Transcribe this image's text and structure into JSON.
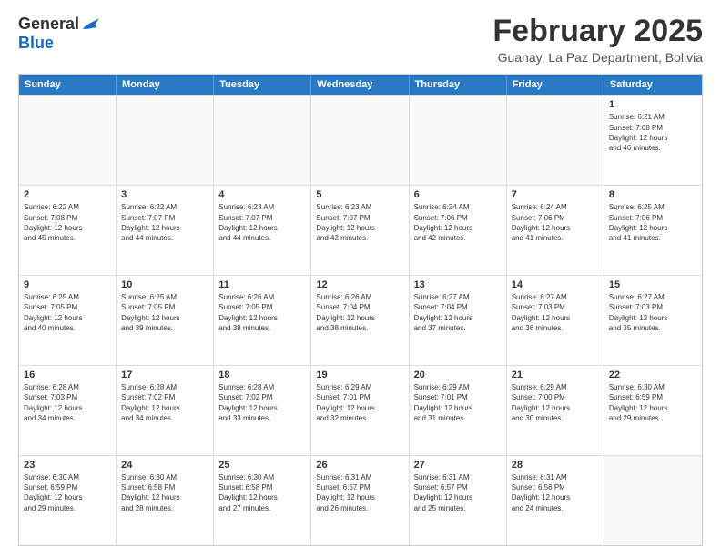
{
  "logo": {
    "general": "General",
    "blue": "Blue"
  },
  "title": "February 2025",
  "subtitle": "Guanay, La Paz Department, Bolivia",
  "days": [
    "Sunday",
    "Monday",
    "Tuesday",
    "Wednesday",
    "Thursday",
    "Friday",
    "Saturday"
  ],
  "weeks": [
    [
      {
        "day": "",
        "info": ""
      },
      {
        "day": "",
        "info": ""
      },
      {
        "day": "",
        "info": ""
      },
      {
        "day": "",
        "info": ""
      },
      {
        "day": "",
        "info": ""
      },
      {
        "day": "",
        "info": ""
      },
      {
        "day": "1",
        "info": "Sunrise: 6:21 AM\nSunset: 7:08 PM\nDaylight: 12 hours\nand 46 minutes."
      }
    ],
    [
      {
        "day": "2",
        "info": "Sunrise: 6:22 AM\nSunset: 7:08 PM\nDaylight: 12 hours\nand 45 minutes."
      },
      {
        "day": "3",
        "info": "Sunrise: 6:22 AM\nSunset: 7:07 PM\nDaylight: 12 hours\nand 44 minutes."
      },
      {
        "day": "4",
        "info": "Sunrise: 6:23 AM\nSunset: 7:07 PM\nDaylight: 12 hours\nand 44 minutes."
      },
      {
        "day": "5",
        "info": "Sunrise: 6:23 AM\nSunset: 7:07 PM\nDaylight: 12 hours\nand 43 minutes."
      },
      {
        "day": "6",
        "info": "Sunrise: 6:24 AM\nSunset: 7:06 PM\nDaylight: 12 hours\nand 42 minutes."
      },
      {
        "day": "7",
        "info": "Sunrise: 6:24 AM\nSunset: 7:06 PM\nDaylight: 12 hours\nand 41 minutes."
      },
      {
        "day": "8",
        "info": "Sunrise: 6:25 AM\nSunset: 7:06 PM\nDaylight: 12 hours\nand 41 minutes."
      }
    ],
    [
      {
        "day": "9",
        "info": "Sunrise: 6:25 AM\nSunset: 7:05 PM\nDaylight: 12 hours\nand 40 minutes."
      },
      {
        "day": "10",
        "info": "Sunrise: 6:25 AM\nSunset: 7:05 PM\nDaylight: 12 hours\nand 39 minutes."
      },
      {
        "day": "11",
        "info": "Sunrise: 6:26 AM\nSunset: 7:05 PM\nDaylight: 12 hours\nand 38 minutes."
      },
      {
        "day": "12",
        "info": "Sunrise: 6:26 AM\nSunset: 7:04 PM\nDaylight: 12 hours\nand 38 minutes."
      },
      {
        "day": "13",
        "info": "Sunrise: 6:27 AM\nSunset: 7:04 PM\nDaylight: 12 hours\nand 37 minutes."
      },
      {
        "day": "14",
        "info": "Sunrise: 6:27 AM\nSunset: 7:03 PM\nDaylight: 12 hours\nand 36 minutes."
      },
      {
        "day": "15",
        "info": "Sunrise: 6:27 AM\nSunset: 7:03 PM\nDaylight: 12 hours\nand 35 minutes."
      }
    ],
    [
      {
        "day": "16",
        "info": "Sunrise: 6:28 AM\nSunset: 7:03 PM\nDaylight: 12 hours\nand 34 minutes."
      },
      {
        "day": "17",
        "info": "Sunrise: 6:28 AM\nSunset: 7:02 PM\nDaylight: 12 hours\nand 34 minutes."
      },
      {
        "day": "18",
        "info": "Sunrise: 6:28 AM\nSunset: 7:02 PM\nDaylight: 12 hours\nand 33 minutes."
      },
      {
        "day": "19",
        "info": "Sunrise: 6:29 AM\nSunset: 7:01 PM\nDaylight: 12 hours\nand 32 minutes."
      },
      {
        "day": "20",
        "info": "Sunrise: 6:29 AM\nSunset: 7:01 PM\nDaylight: 12 hours\nand 31 minutes."
      },
      {
        "day": "21",
        "info": "Sunrise: 6:29 AM\nSunset: 7:00 PM\nDaylight: 12 hours\nand 30 minutes."
      },
      {
        "day": "22",
        "info": "Sunrise: 6:30 AM\nSunset: 6:59 PM\nDaylight: 12 hours\nand 29 minutes."
      }
    ],
    [
      {
        "day": "23",
        "info": "Sunrise: 6:30 AM\nSunset: 6:59 PM\nDaylight: 12 hours\nand 29 minutes."
      },
      {
        "day": "24",
        "info": "Sunrise: 6:30 AM\nSunset: 6:58 PM\nDaylight: 12 hours\nand 28 minutes."
      },
      {
        "day": "25",
        "info": "Sunrise: 6:30 AM\nSunset: 6:58 PM\nDaylight: 12 hours\nand 27 minutes."
      },
      {
        "day": "26",
        "info": "Sunrise: 6:31 AM\nSunset: 6:57 PM\nDaylight: 12 hours\nand 26 minutes."
      },
      {
        "day": "27",
        "info": "Sunrise: 6:31 AM\nSunset: 6:57 PM\nDaylight: 12 hours\nand 25 minutes."
      },
      {
        "day": "28",
        "info": "Sunrise: 6:31 AM\nSunset: 6:56 PM\nDaylight: 12 hours\nand 24 minutes."
      },
      {
        "day": "",
        "info": ""
      }
    ]
  ]
}
